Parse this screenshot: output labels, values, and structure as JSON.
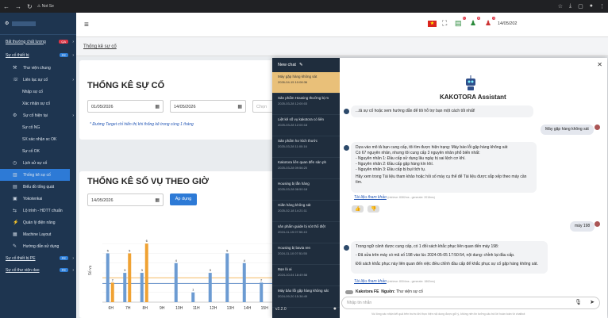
{
  "browser": {
    "tab": "Not Se",
    "icons": [
      "star-icon",
      "download-icon",
      "extension-icon"
    ]
  },
  "sidebar": {
    "items": [
      {
        "label": "Bất thường chất lượng",
        "badge": "QA",
        "type": "top"
      },
      {
        "label": "Sự cố thiết bị",
        "badge": "PE",
        "type": "top"
      },
      {
        "label": "Thư viện chung",
        "type": "mid"
      },
      {
        "label": "Liên lạc sự cố",
        "type": "mid"
      },
      {
        "label": "Nhập sự cố",
        "type": "sub"
      },
      {
        "label": "Xác nhận sự cố",
        "type": "sub"
      },
      {
        "label": "Sự cố hiện tại",
        "type": "mid"
      },
      {
        "label": "Sự cố NG",
        "type": "sub"
      },
      {
        "label": "SX xác nhận sc OK",
        "type": "sub"
      },
      {
        "label": "Sự cố OK",
        "type": "sub"
      },
      {
        "label": "Lịch sử sự cố",
        "type": "mid"
      },
      {
        "label": "Thống kê sự cố",
        "type": "mid",
        "active": true
      },
      {
        "label": "Biểu đồ tổng quát",
        "type": "mid"
      },
      {
        "label": "Yokotenkai",
        "type": "mid"
      },
      {
        "label": "Lộ trình - HDTT chuẩn",
        "type": "mid"
      },
      {
        "label": "Quản lý điện năng",
        "type": "mid"
      },
      {
        "label": "Machine Layout",
        "type": "mid"
      },
      {
        "label": "Hướng dẫn sử dụng",
        "type": "mid"
      },
      {
        "label": "Sự cố thiết bị PE",
        "badge": "PE",
        "type": "top"
      },
      {
        "label": "Sự cố thư viện dao",
        "badge": "PE",
        "type": "top"
      }
    ]
  },
  "topbar": {
    "date": "14/05/202",
    "badges": [
      "1",
      "6",
      "1"
    ]
  },
  "breadcrumb": "Thống kê sự cố",
  "stats": {
    "title": "THỐNG KÊ SỰ CỐ",
    "from": "01/05/2026",
    "to": "14/05/2026",
    "choose_placeholder": "Chọn",
    "note": "* Đường Target chỉ hiển thị khi thống kê trong cùng 1 tháng"
  },
  "hourly": {
    "title": "THỐNG KÊ SỐ VỤ THEO GIỜ",
    "date": "14/05/2026",
    "apply": "Áp dụng"
  },
  "chart_data": {
    "type": "bar",
    "categories": [
      "6H",
      "7H",
      "8H",
      "9H",
      "10H",
      "11H",
      "12H",
      "13H",
      "14H",
      "15H"
    ],
    "ylabel": "Số vụ",
    "series": [
      {
        "color": "#6c9bd2",
        "values": [
          5,
          3,
          3,
          0,
          4,
          1,
          3,
          5,
          4,
          2
        ]
      },
      {
        "color": "#f0a233",
        "values": [
          2,
          5,
          6,
          0,
          0,
          0,
          0,
          0,
          0,
          0
        ]
      }
    ]
  },
  "chat": {
    "new_chat": "New chat",
    "version": "v2.2.0",
    "history": [
      {
        "t": "Máy gặp hàng không sát",
        "d": "2026-04-15 10:08:36",
        "sel": true
      },
      {
        "t": "Sản phẩm Housing thường bị m",
        "d": "2025-03-28 12:00:03"
      },
      {
        "t": "Liệt kê số vụ kakotora có liên",
        "d": "2025-03-28 12:00:18"
      },
      {
        "t": "Sản phẩm hư kích thước",
        "d": "2025-03-28 11:00:16"
      },
      {
        "t": "Kakotora liên quan đến sản ph",
        "d": "2025-03-28 09:56:20"
      },
      {
        "t": "Housing bị lẫn hàng",
        "d": "2025-03-28 08:50:18"
      },
      {
        "t": "Giãn hàng không sát",
        "d": "2025-02-18 14:21:11"
      },
      {
        "t": "sản phẩm guide bị sót thổ điệt",
        "d": "2024-11-15 07:50:43"
      },
      {
        "t": "Housing bị bavia ren",
        "d": "2024-11-10 07:51:55"
      },
      {
        "t": "Bạn là ai",
        "d": "2024-10-04 18:49:58"
      },
      {
        "t": "Máy báo lỗi gặp hàng không sát",
        "d": "2024-09-20 15:36:49"
      }
    ],
    "assistant_name": "KAKOTORA Assistant",
    "greet": "...tả sự cố hoặc xem hướng dẫn để tôi hỗ trợ bạn một cách tốt nhất!",
    "user1": "Máy gặp hàng không sát",
    "bot1": [
      "Dựa vào mô tả bạn cung cấp, tôi tìm được hiện trạng: Máy báo lỗi gặp hàng không sát",
      "Có 67 nguyên nhân, nhưng tôi cung cấp 3 nguyên nhân phổ biến nhất:",
      "- Nguyên nhân 1: Đầu cấp sử dụng lâu ngày bị sai lệch cơ khí.",
      "- Nguyên nhân 2: Đầu cấp gặp hàng kín khí.",
      "- Nguyên nhân 3: Đầu cấp bị bụi tích tụ."
    ],
    "bot1_tail": "Hãy xem trong Tài liệu tham khảo hoặc hỏi số máy cụ thể để Tài liệu được sắp xếp theo máy cần tìm.",
    "ref": "Tài liệu tham khảo",
    "meta1": "(retrieve: 8082ms - generate: 2016ms)",
    "user2": "máy 198",
    "bot2": [
      "Trong ngữ cảnh được cung cấp, có 1 đối sách khắc phục liên quan đến máy 198:",
      "- Đã sửa trên máy có mã số 198 vào lúc 2024-05-05 17:50:54, nội dung: chỉnh lại đầu cấp.",
      "Đối sách khắc phục này liên quan đến việc điều chỉnh đầu cấp để khắc phục sự cố gặp hàng không sát."
    ],
    "meta2": "(retrieve: 8004ms - generate: 1862ms)",
    "toggle_label": "Kakotora FE",
    "source_label": "Nguồn:",
    "source_value": "Thư viện sự cố",
    "input_placeholder": "Nhập tin nhắn",
    "footer": "Vui lòng xác nhận kết quả trên trước khi thực hiện nội dung được gửi ý, không nên tin tưởng câu trả lời hoàn toàn từ chatbot"
  }
}
